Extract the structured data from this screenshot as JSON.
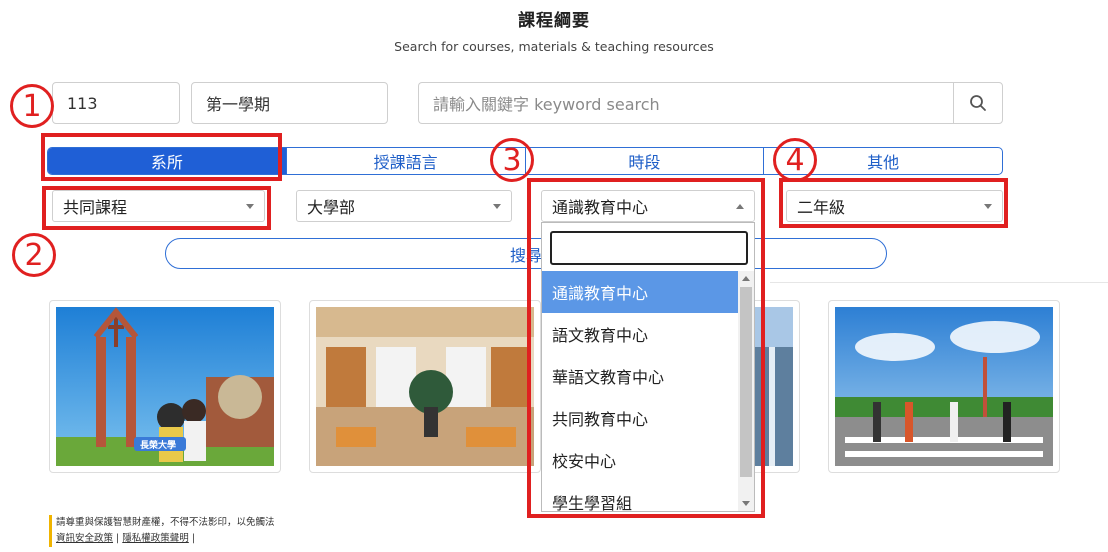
{
  "header": {
    "title": "課程綱要",
    "subtitle": "Search for courses, materials & teaching resources"
  },
  "filters": {
    "year": "113",
    "semester": "第一學期",
    "search_placeholder": "請輸入關鍵字 keyword search"
  },
  "tabs": [
    {
      "label": "系所",
      "active": true
    },
    {
      "label": "授課語言",
      "active": false
    },
    {
      "label": "時段",
      "active": false
    },
    {
      "label": "其他",
      "active": false
    }
  ],
  "selects": {
    "category": "共同課程",
    "level": "大學部",
    "unit": "通識教育中心",
    "grade": "二年級"
  },
  "search_button_label": "搜尋",
  "dropdown": {
    "search_value": "",
    "options": [
      "通識教育中心",
      "語文教育中心",
      "華語文教育中心",
      "共同教育中心",
      "校安中心",
      "學生學習組"
    ],
    "highlighted_index": 0
  },
  "photos": {
    "campus_sign": "長榮大學"
  },
  "footer": {
    "notice": "請尊重與保護智慧財產權，不得不法影印，以免觸法",
    "link1": "資訊安全政策",
    "separator": "|",
    "link2": "隱私權政策聲明"
  },
  "annotations": [
    "1",
    "2",
    "3",
    "4"
  ],
  "colors": {
    "primary": "#1f5fd6",
    "highlight": "#5b97e6",
    "annotation": "#e02020",
    "footer_bar": "#f0b400"
  }
}
